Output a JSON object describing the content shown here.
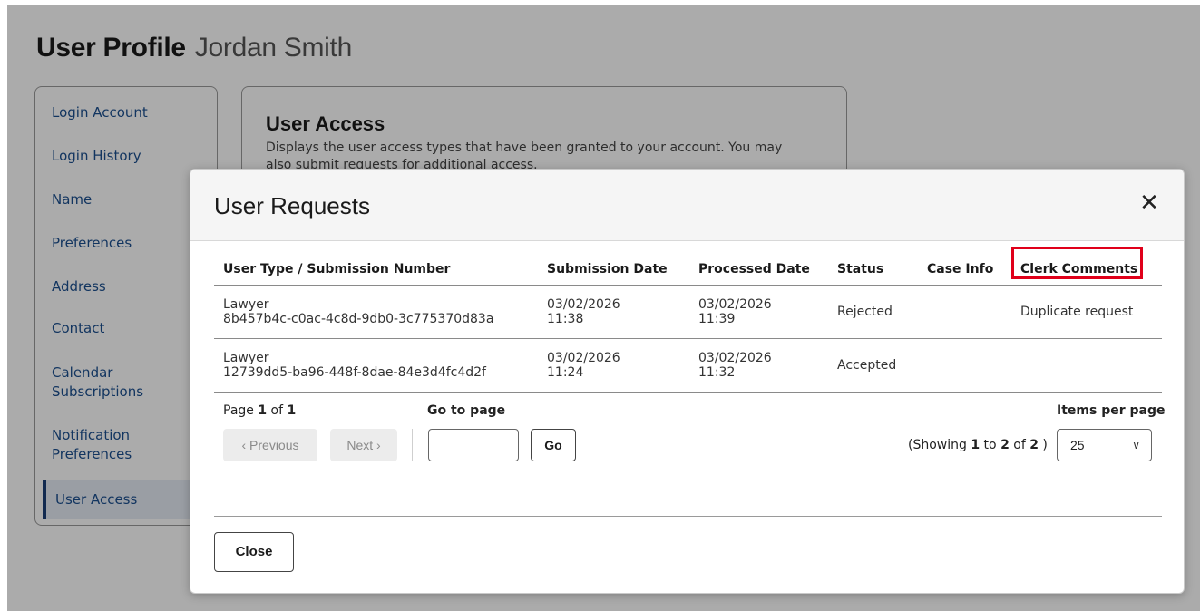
{
  "page": {
    "title": "User Profile",
    "user_name": "Jordan Smith"
  },
  "sidebar": {
    "items": [
      {
        "label": "Login Account"
      },
      {
        "label": "Login History"
      },
      {
        "label": "Name"
      },
      {
        "label": "Preferences"
      },
      {
        "label": "Address"
      },
      {
        "label": "Contact"
      },
      {
        "label": "Calendar Subscriptions"
      },
      {
        "label": "Notification Preferences"
      },
      {
        "label": "User Access",
        "active": true
      }
    ]
  },
  "access_card": {
    "title": "User Access",
    "description": "Displays the user access types that have been granted to your account. You may also submit requests for additional access."
  },
  "modal": {
    "title": "User Requests",
    "close_icon": "close-icon",
    "columns": [
      "User Type / Submission Number",
      "Submission Date",
      "Processed Date",
      "Status",
      "Case Info",
      "Clerk Comments"
    ],
    "rows": [
      {
        "user_type": "Lawyer",
        "submission_number": "8b457b4c-c0ac-4c8d-9db0-3c775370d83a",
        "submission_date": "03/02/2026",
        "submission_time": "11:38",
        "processed_date": "03/02/2026",
        "processed_time": "11:39",
        "status": "Rejected",
        "case_info": "",
        "clerk_comments": "Duplicate request"
      },
      {
        "user_type": "Lawyer",
        "submission_number": "12739dd5-ba96-448f-8dae-84e3d4fc4d2f",
        "submission_date": "03/02/2026",
        "submission_time": "11:24",
        "processed_date": "03/02/2026",
        "processed_time": "11:32",
        "status": "Accepted",
        "case_info": "",
        "clerk_comments": ""
      }
    ],
    "pager": {
      "page_prefix": "Page ",
      "current_page": "1",
      "of_text": " of ",
      "total_pages": "1",
      "goto_label": "Go to page",
      "prev_label": "‹ Previous",
      "next_label": "Next ›",
      "go_label": "Go",
      "goto_value": "",
      "showing_prefix": "(Showing ",
      "showing_from": "1",
      "showing_to_text": " to ",
      "showing_to": "2",
      "showing_of_text": " of ",
      "showing_total": "2",
      "showing_suffix": " )",
      "items_per_page_label": "Items per page",
      "items_per_page_value": "25"
    },
    "close_label": "Close"
  },
  "colors": {
    "highlight": "#e0001a",
    "link": "#1c4f8f",
    "overlay": "rgba(0,0,0,0.33)"
  }
}
